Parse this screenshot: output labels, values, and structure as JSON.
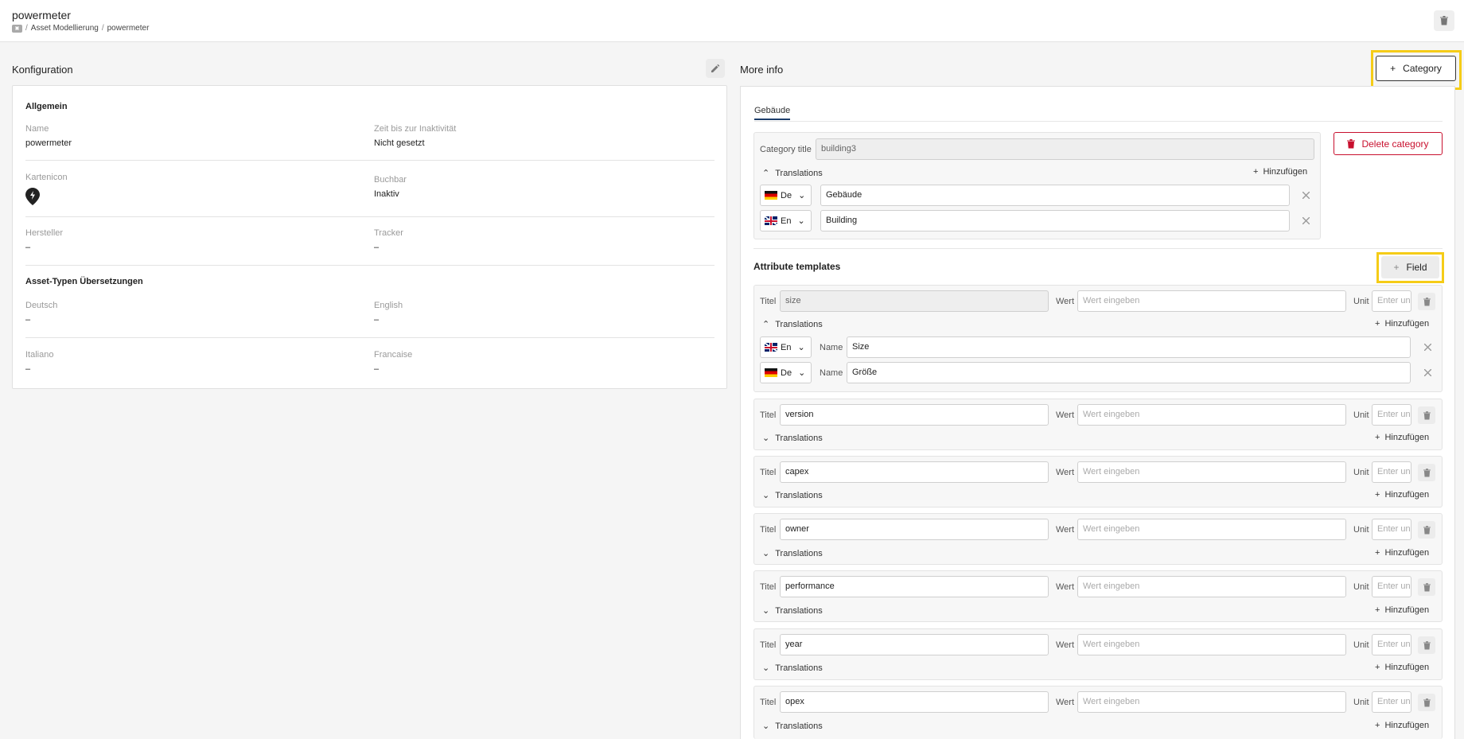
{
  "header": {
    "title": "powermeter",
    "breadcrumb": [
      "Asset Modellierung",
      "powermeter"
    ],
    "breadcrumb_home_icon": "home-icon",
    "delete_icon": "trash-icon"
  },
  "konfiguration": {
    "heading": "Konfiguration",
    "edit_icon": "pencil-icon",
    "allgemein_title": "Allgemein",
    "fields": {
      "name_label": "Name",
      "name_value": "powermeter",
      "inactivity_label": "Zeit bis zur Inaktivität",
      "inactivity_value": "Nicht gesetzt",
      "kartenicon_label": "Kartenicon",
      "kartenicon_icon": "map-pin-bolt-icon",
      "buchbar_label": "Buchbar",
      "buchbar_value": "Inaktiv",
      "hersteller_label": "Hersteller",
      "hersteller_value": "–",
      "tracker_label": "Tracker",
      "tracker_value": "–"
    },
    "translations_title": "Asset-Typen Übersetzungen",
    "translations": {
      "deutsch_label": "Deutsch",
      "deutsch_value": "–",
      "english_label": "English",
      "english_value": "–",
      "italiano_label": "Italiano",
      "italiano_value": "–",
      "francaise_label": "Francaise",
      "francaise_value": "–"
    }
  },
  "more_info": {
    "heading": "More info",
    "category_button": "Category",
    "tab": "Gebäude",
    "category_title_label": "Category title",
    "category_title_value": "building3",
    "translations_label": "Translations",
    "add_label": "Hinzufügen",
    "delete_category_button": "Delete category",
    "category_translations": [
      {
        "lang": "De",
        "value": "Gebäude"
      },
      {
        "lang": "En",
        "value": "Building"
      }
    ],
    "attr_heading": "Attribute templates",
    "field_button": "Field",
    "labels": {
      "titel": "Titel",
      "wert": "Wert",
      "unit": "Unit",
      "name": "Name"
    },
    "wert_placeholder": "Wert eingeben",
    "unit_placeholder": "Enter unit",
    "attributes": [
      {
        "title": "size",
        "translations": [
          {
            "lang": "En",
            "name": "Size"
          },
          {
            "lang": "De",
            "name": "Größe"
          }
        ]
      },
      {
        "title": "version"
      },
      {
        "title": "capex"
      },
      {
        "title": "owner"
      },
      {
        "title": "performance"
      },
      {
        "title": "year"
      },
      {
        "title": "opex"
      }
    ]
  },
  "colors": {
    "accent": "#1d3d6b",
    "danger": "#c8102e",
    "highlight": "#f5cc17"
  }
}
